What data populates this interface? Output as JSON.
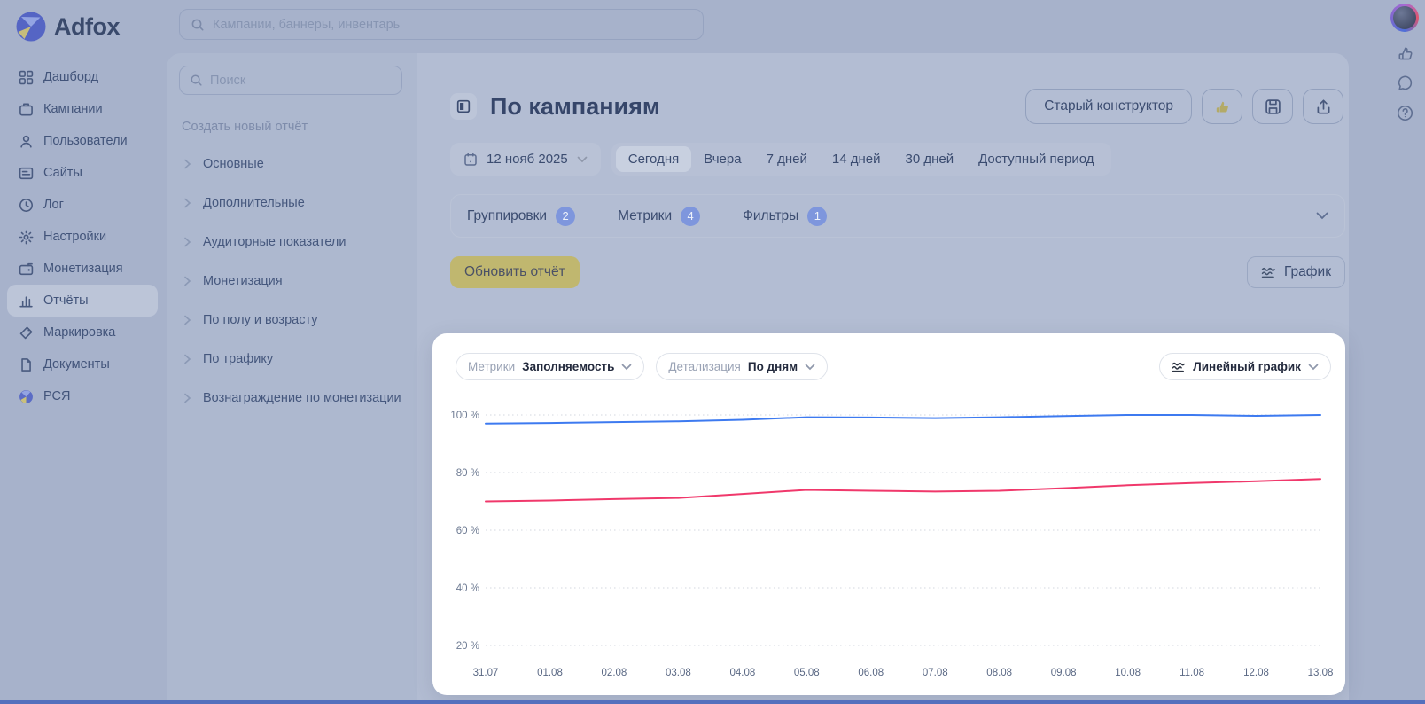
{
  "app": {
    "name": "Adfox"
  },
  "global_search": {
    "placeholder": "Кампании, баннеры, инвентарь"
  },
  "sidebar": {
    "active_item": "Отчёты",
    "items": [
      {
        "label": "Дашборд",
        "icon": "dashboard-icon"
      },
      {
        "label": "Кампании",
        "icon": "campaigns-icon"
      },
      {
        "label": "Пользователи",
        "icon": "users-icon"
      },
      {
        "label": "Сайты",
        "icon": "sites-icon"
      },
      {
        "label": "Лог",
        "icon": "log-icon"
      },
      {
        "label": "Настройки",
        "icon": "settings-icon"
      },
      {
        "label": "Монетизация",
        "icon": "monetization-icon"
      },
      {
        "label": "Отчёты",
        "icon": "reports-icon"
      },
      {
        "label": "Маркировка",
        "icon": "marking-icon"
      },
      {
        "label": "Документы",
        "icon": "documents-icon"
      },
      {
        "label": "РСЯ",
        "icon": "rsya-icon"
      }
    ]
  },
  "reports_panel": {
    "search_placeholder": "Поиск",
    "create_new_label": "Создать новый отчёт",
    "groups": [
      "Основные",
      "Дополнительные",
      "Аудиторные показатели",
      "Монетизация",
      "По полу и возрасту",
      "По трафику",
      "Вознаграждение по монетизации"
    ]
  },
  "report": {
    "title": "По кампаниям",
    "old_constructor_label": "Старый конструктор"
  },
  "date_filter": {
    "date_value": "12 нояб 2025",
    "selected_period": "Сегодня",
    "periods": [
      "Сегодня",
      "Вчера",
      "7 дней",
      "14 дней",
      "30 дней",
      "Доступный период"
    ]
  },
  "filter_bar": {
    "groups_label": "Группировки",
    "groups_count": "2",
    "metrics_label": "Метрики",
    "metrics_count": "4",
    "filters_label": "Фильтры",
    "filters_count": "1"
  },
  "actions": {
    "update_report": "Обновить отчёт",
    "chart_toggle": "График"
  },
  "chart_controls": {
    "metrics_label": "Метрики",
    "metrics_value": "Заполняемость",
    "detail_label": "Детализация",
    "detail_value": "По дням",
    "chart_type_value": "Линейный график"
  },
  "chart_data": {
    "type": "line",
    "x": [
      "31.07",
      "01.08",
      "02.08",
      "03.08",
      "04.08",
      "05.08",
      "06.08",
      "07.08",
      "08.08",
      "09.08",
      "10.08",
      "11.08",
      "12.08",
      "13.08"
    ],
    "series": [
      {
        "color": "#3d7af0",
        "values": [
          97.0,
          97.2,
          97.5,
          97.8,
          98.3,
          99.2,
          99.1,
          98.9,
          99.2,
          99.6,
          100,
          100,
          99.7,
          100
        ]
      },
      {
        "color": "#f0386b",
        "values": [
          70.0,
          70.3,
          70.8,
          71.2,
          72.6,
          74.0,
          73.7,
          73.4,
          73.7,
          74.6,
          75.6,
          76.4,
          77.0,
          77.8
        ]
      }
    ],
    "ylim": [
      20,
      100
    ],
    "yticks": [
      100,
      80,
      60,
      40,
      20
    ],
    "ytick_suffix": " %",
    "grid": "horizontal-dotted",
    "legend": "none"
  },
  "colors": {
    "line_blue": "#3d7af0",
    "line_red": "#f0386b",
    "badge_blue": "#7e96dd",
    "khaki_button": "#c0b76f"
  }
}
